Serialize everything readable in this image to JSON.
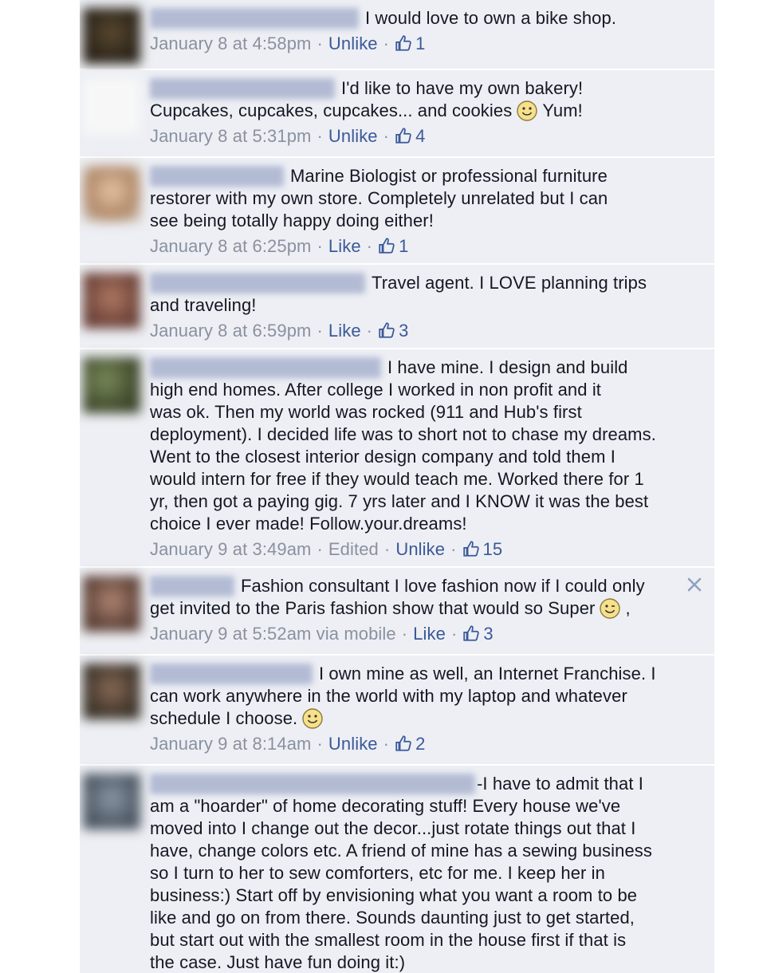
{
  "comments": [
    {
      "text": "I would love to own a bike shop.",
      "date": "January 8 at 4:58pm",
      "action": "Unlike",
      "likes": "1",
      "avatar_color": "#3a2e1e"
    },
    {
      "text": "I'd like to have my own bakery!\nCupcakes, cupcakes, cupcakes... and cookies",
      "text_after": "Yum!",
      "date": "January 8 at 5:31pm",
      "action": "Unlike",
      "likes": "4",
      "avatar_color": "#f4f4f4"
    },
    {
      "text": "Marine Biologist or professional furniture\nrestorer with my own store. Completely unrelated but I can\nsee being totally happy doing either!",
      "date": "January 8 at 6:25pm",
      "action": "Like",
      "likes": "1",
      "avatar_color": "#c49a7a"
    },
    {
      "text": "Travel agent. I LOVE planning trips\nand traveling!",
      "date": "January 8 at 6:59pm",
      "action": "Like",
      "likes": "3",
      "avatar_color": "#8a5a4a"
    },
    {
      "text": "I have mine. I design and build\nhigh end homes. After college I worked in non profit and it\nwas ok. Then my world was rocked (911 and Hub's first\ndeployment). I decided life was to short not to chase my dreams.\nWent to the closest interior design company and told them I\nwould intern for free if they would teach me. Worked there for 1\nyr, then got a paying gig. 7 yrs later and I KNOW it was the best\nchoice I ever made! Follow.your.dreams!",
      "date": "January 9 at 3:49am",
      "edited": "Edited",
      "action": "Unlike",
      "likes": "15",
      "avatar_color": "#4e5a3a"
    },
    {
      "text": "Fashion consultant I love fashion now if I could only\nget invited to the Paris fashion show that would so Super",
      "text_after": ",",
      "date": "January 9 at 5:52am via mobile",
      "action": "Like",
      "likes": "3",
      "avatar_color": "#8a6454"
    },
    {
      "text": "I own mine as well, an Internet Franchise. I\ncan work anywhere in the world with my laptop and whatever\nschedule I choose.",
      "date": "January 9 at 8:14am",
      "action": "Unlike",
      "likes": "2",
      "avatar_color": "#5a4a3e"
    },
    {
      "text": "-I have to admit that I\nam a \"hoarder\" of home decorating stuff! Every house we've\nmoved into I change out the decor...just rotate things out that I\nhave, change colors etc. A friend of mine has a sewing business\nso I turn to her to sew comforters, etc for me. I keep her in\nbusiness:) Start off by envisioning what you want a room to be\nlike and go on from there. Sounds daunting just to get started,\nbut start out with the smallest room in the house first if that is\nthe case. Just have fun doing it:)",
      "avatar_color": "#6a7482"
    }
  ],
  "colors": {
    "link": "#3b5998",
    "meta": "#8a919f",
    "background": "#edeff4",
    "text": "#141823"
  },
  "icons": {
    "like": "thumbs-up-icon",
    "emoticon": "smiley-icon",
    "remove": "close-icon"
  }
}
